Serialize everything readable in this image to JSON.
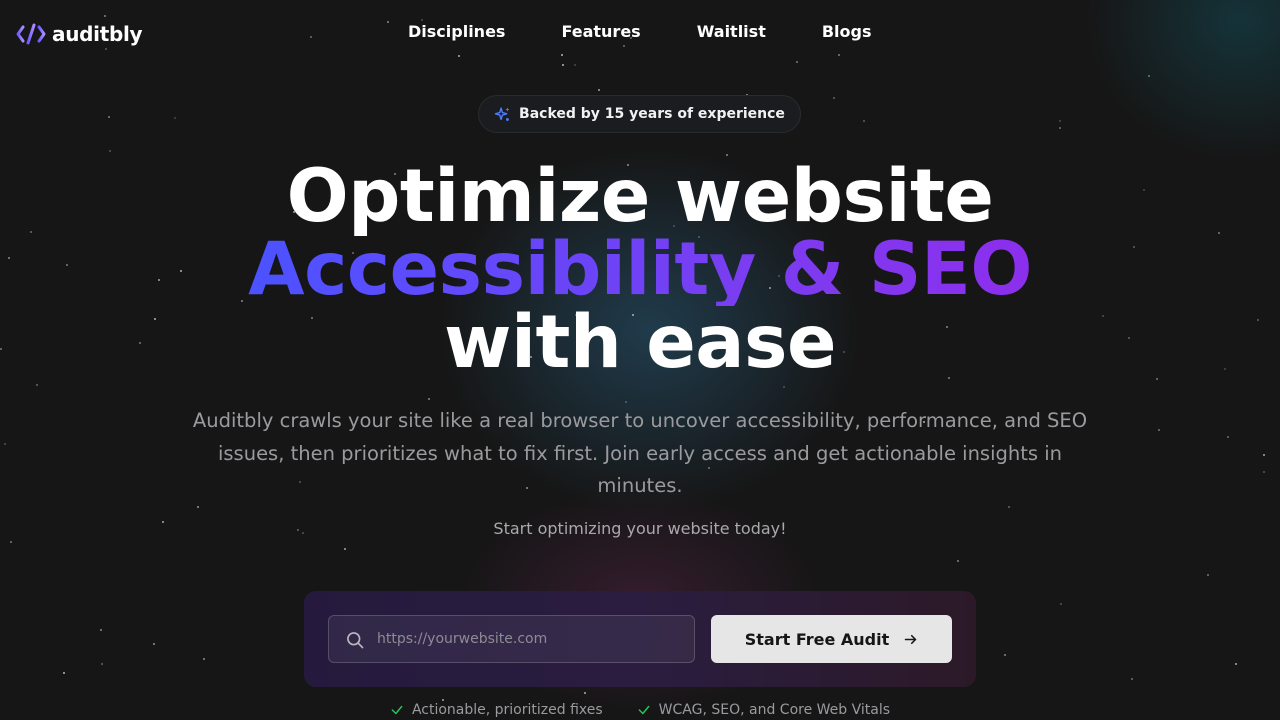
{
  "brand": {
    "name": "auditbly",
    "logo_icon": "code-slash-icon"
  },
  "nav": {
    "items": [
      "Disciplines",
      "Features",
      "Waitlist",
      "Blogs"
    ]
  },
  "badge": {
    "icon": "sparkles-icon",
    "text": "Backed by 15 years of experience"
  },
  "hero": {
    "line1": "Optimize website",
    "line2": "Accessibility & SEO",
    "line3": "with ease",
    "description": "Auditbly crawls your site like a real browser to uncover accessibility, performance, and SEO issues, then prioritizes what to fix first. Join early access and get actionable insights in minutes.",
    "tagline": "Start optimizing your website today!"
  },
  "form": {
    "placeholder": "https://yourwebsite.com",
    "value": "",
    "button_label": "Start Free Audit",
    "button_icon": "arrow-right-icon",
    "search_icon": "search-icon"
  },
  "features": [
    "Actionable, prioritized fixes",
    "WCAG, SEO, and Core Web Vitals"
  ],
  "colors": {
    "background": "#161616",
    "gradient_start": "#2f5cff",
    "gradient_end": "#9b22ea",
    "check": "#22c55e",
    "button_bg": "#e6e6e6"
  }
}
